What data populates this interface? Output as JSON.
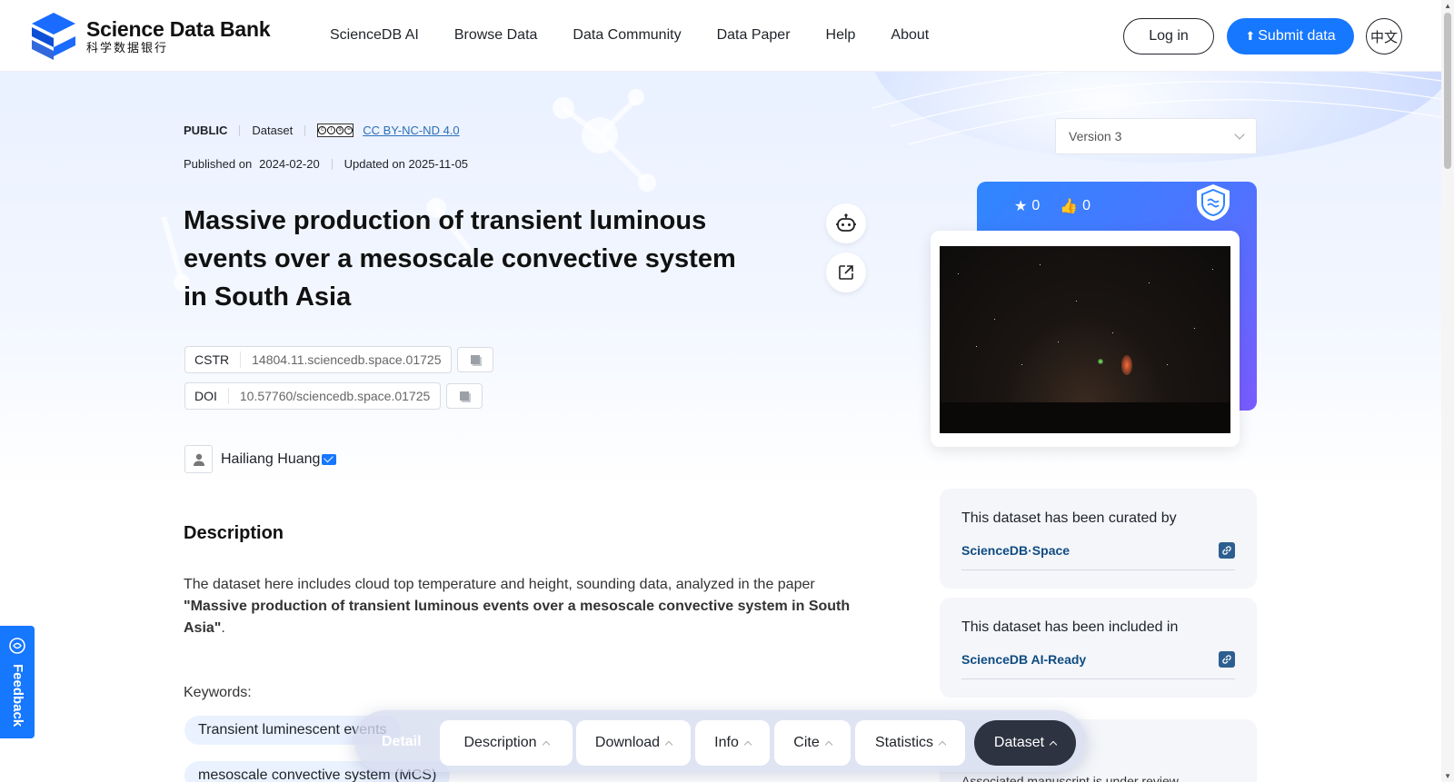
{
  "header": {
    "logo_en": "Science Data Bank",
    "logo_cn": "科学数据银行",
    "nav": [
      "ScienceDB AI",
      "Browse Data",
      "Data Community",
      "Data Paper",
      "Help",
      "About"
    ],
    "login": "Log in",
    "submit": "Submit data",
    "lang": "中文"
  },
  "meta": {
    "visibility": "PUBLIC",
    "type": "Dataset",
    "license": "CC BY-NC-ND 4.0",
    "published_label": "Published on",
    "published_date": "2024-02-20",
    "updated": "Updated on 2025-11-05"
  },
  "title": "Massive production of transient luminous events over a mesoscale convective system in South Asia",
  "ids": {
    "cstr_key": "CSTR",
    "cstr_value": "14804.11.sciencedb.space.01725",
    "doi_key": "DOI",
    "doi_value": "10.57760/sciencedb.space.01725"
  },
  "author": "Hailiang Huang",
  "description": {
    "heading": "Description",
    "text_before": "The dataset here includes cloud top temperature and height, sounding data, analyzed in the paper ",
    "text_bold": "\"Massive production of transient luminous events over a mesoscale convective system in South Asia\"",
    "text_after": "."
  },
  "keywords": {
    "label": "Keywords:",
    "items": [
      "Transient luminescent events",
      "mesoscale convective system (MCS)"
    ]
  },
  "version": "Version 3",
  "stats": {
    "stars": "0",
    "likes": "0"
  },
  "curated": {
    "label": "This dataset has been curated by",
    "link": "ScienceDB·Space"
  },
  "included": {
    "label": "This dataset has been included in",
    "link": "ScienceDB AI-Ready"
  },
  "manuscript": "Associated manuscript is under review",
  "feedback": "Feedback",
  "tabbar": {
    "detail": "Detail",
    "tabs": [
      "Description",
      "Download",
      "Info",
      "Cite",
      "Statistics",
      "Dataset"
    ]
  },
  "colors": {
    "accent": "#1677ff",
    "dark_tab": "#2d3340",
    "link": "#0f4c81"
  }
}
